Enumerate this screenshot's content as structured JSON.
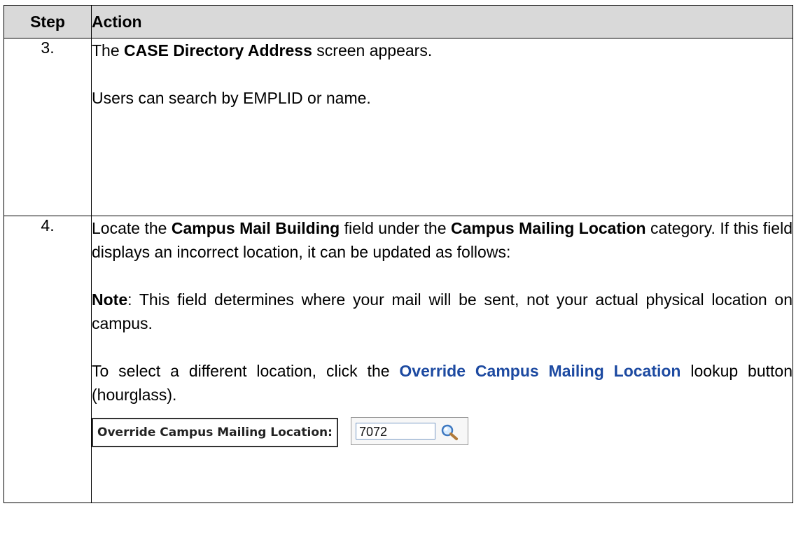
{
  "header": {
    "step": "Step",
    "action": "Action"
  },
  "rows": [
    {
      "number": "3.",
      "line1": {
        "pre": "The ",
        "bold": "CASE Directory Address",
        "post": " screen appears."
      },
      "line2": "Users can search by EMPLID or name."
    },
    {
      "number": "4.",
      "para1": {
        "t1": "Locate the ",
        "b1": "Campus Mail Building",
        "t2": " field under the ",
        "b2": "Campus Mailing Location",
        "t3": " category. If this field displays an incorrect location, it can be updated as follows:"
      },
      "note": {
        "label": "Note",
        "text": ": This field determines where your mail will be sent, not your actual physical location on campus."
      },
      "para3": {
        "t1": "To select a different location, click the ",
        "link": "Override Campus Mailing Location",
        "t2": " lookup button (hourglass)."
      },
      "screenshot": {
        "label": "Override Campus Mailing Location:",
        "value": "7072",
        "icon": "magnifier-lookup-icon"
      }
    }
  ],
  "colors": {
    "header_bg": "#d9d9d9",
    "link": "#1d4aa1"
  }
}
